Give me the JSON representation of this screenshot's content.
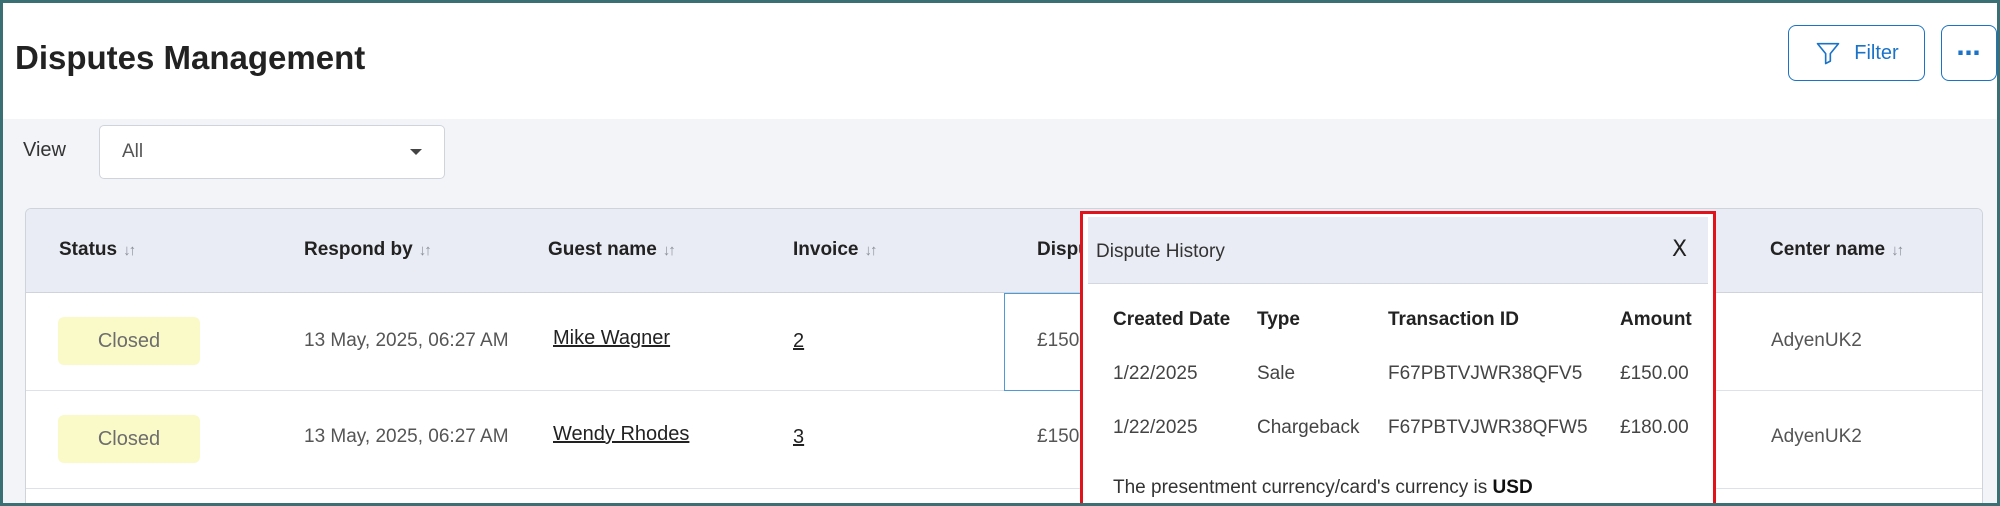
{
  "header": {
    "title": "Disputes Management",
    "filter_label": "Filter",
    "more_label": "⋯"
  },
  "view": {
    "label": "View",
    "selected": "All"
  },
  "table": {
    "columns": [
      "Status",
      "Respond by",
      "Guest name",
      "Invoice",
      "Dispu",
      "Center name"
    ],
    "sort_glyph": "↓↑",
    "rows": [
      {
        "status": "Closed",
        "respond_by": "13 May, 2025, 06:27 AM",
        "guest_name": "Mike Wagner",
        "invoice": "2",
        "dispute_amount": "£150",
        "center_name": "AdyenUK2"
      },
      {
        "status": "Closed",
        "respond_by": "13 May, 2025, 06:27 AM",
        "guest_name": "Wendy Rhodes",
        "invoice": "3",
        "dispute_amount": "£150",
        "center_name": "AdyenUK2"
      }
    ]
  },
  "popup": {
    "title": "Dispute History",
    "close_label": "X",
    "columns": [
      "Created Date",
      "Type",
      "Transaction ID",
      "Amount"
    ],
    "rows": [
      {
        "created_date": "1/22/2025",
        "type": "Sale",
        "transaction_id": "F67PBTVJWR38QFV5",
        "amount": "£150.00"
      },
      {
        "created_date": "1/22/2025",
        "type": "Chargeback",
        "transaction_id": "F67PBTVJWR38QFW5",
        "amount": "£180.00"
      }
    ],
    "note_prefix": "The presentment currency/card's currency is ",
    "note_currency": "USD"
  },
  "colors": {
    "accent": "#1a73c8",
    "highlight_border": "#e0131b",
    "status_bg": "#fafac8",
    "frame_border": "#3a6f74"
  }
}
